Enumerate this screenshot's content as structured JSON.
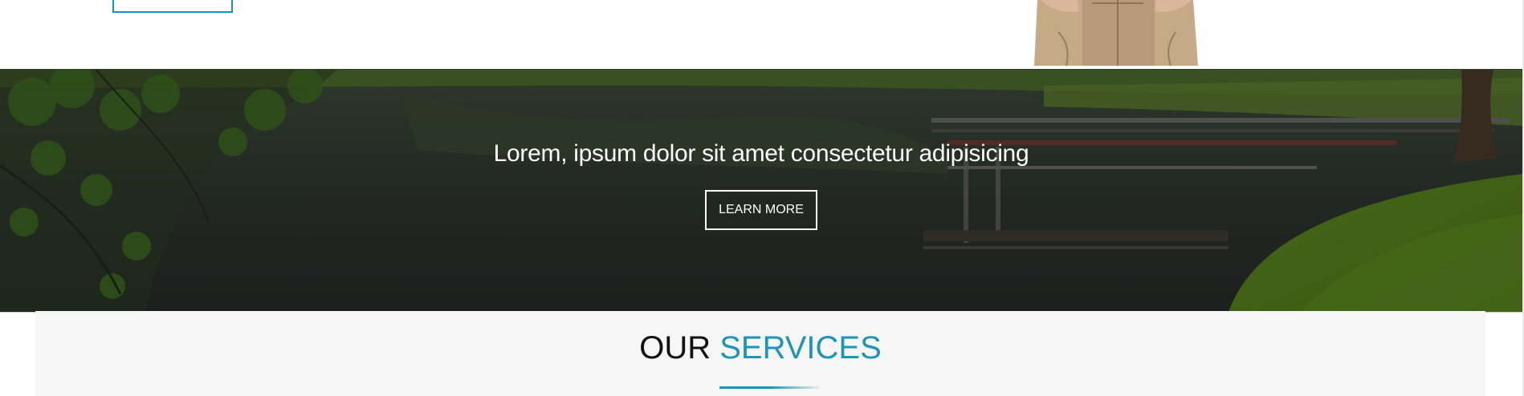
{
  "banner": {
    "heading": "Lorem, ipsum dolor sit amet consectetur adipisicing",
    "button_label": "LEARN MORE"
  },
  "services": {
    "title_main": "OUR",
    "title_accent": "SERVICES"
  },
  "colors": {
    "accent": "#1a93b8",
    "section_bg": "#f6f6f6"
  }
}
